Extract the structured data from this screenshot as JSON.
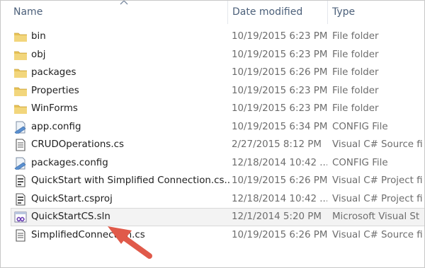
{
  "columns": {
    "name": "Name",
    "date": "Date modified",
    "type": "Type"
  },
  "sort_indicator_icon": "chevron-up-icon",
  "colors": {
    "folder": "#e7c257",
    "header_text": "#4c607a",
    "arrow": "#e05a4a"
  },
  "files": [
    {
      "name": "bin",
      "date": "10/19/2015 6:23 PM",
      "type": "File folder",
      "icon": "folder-icon"
    },
    {
      "name": "obj",
      "date": "10/19/2015 6:23 PM",
      "type": "File folder",
      "icon": "folder-icon"
    },
    {
      "name": "packages",
      "date": "10/19/2015 6:26 PM",
      "type": "File folder",
      "icon": "folder-icon"
    },
    {
      "name": "Properties",
      "date": "10/19/2015 6:23 PM",
      "type": "File folder",
      "icon": "folder-icon"
    },
    {
      "name": "WinForms",
      "date": "10/19/2015 6:23 PM",
      "type": "File folder",
      "icon": "folder-icon"
    },
    {
      "name": "app.config",
      "date": "10/19/2015 6:34 PM",
      "type": "CONFIG File",
      "icon": "config-file-icon"
    },
    {
      "name": "CRUDOperations.cs",
      "date": "2/27/2015 8:12 PM",
      "type": "Visual C# Source fi",
      "icon": "csharp-source-icon"
    },
    {
      "name": "packages.config",
      "date": "12/18/2014 10:42 ...",
      "type": "CONFIG File",
      "icon": "config-file-icon"
    },
    {
      "name": "QuickStart with Simplified Connection.cs...",
      "date": "10/19/2015 6:26 PM",
      "type": "Visual C# Project fi",
      "icon": "csproj-icon"
    },
    {
      "name": "QuickStart.csproj",
      "date": "12/18/2014 10:42 ...",
      "type": "Visual C# Project fi",
      "icon": "csproj-icon"
    },
    {
      "name": "QuickStartCS.sln",
      "date": "12/1/2014 5:20 PM",
      "type": "Microsoft Visual St",
      "icon": "solution-file-icon",
      "selected": true
    },
    {
      "name": "SimplifiedConnection.cs",
      "date": "10/19/2015 6:26 PM",
      "type": "Visual C# Source fi",
      "icon": "csharp-source-icon"
    }
  ],
  "annotation": {
    "icon": "red-arrow-icon",
    "points_to": "QuickStartCS.sln"
  }
}
